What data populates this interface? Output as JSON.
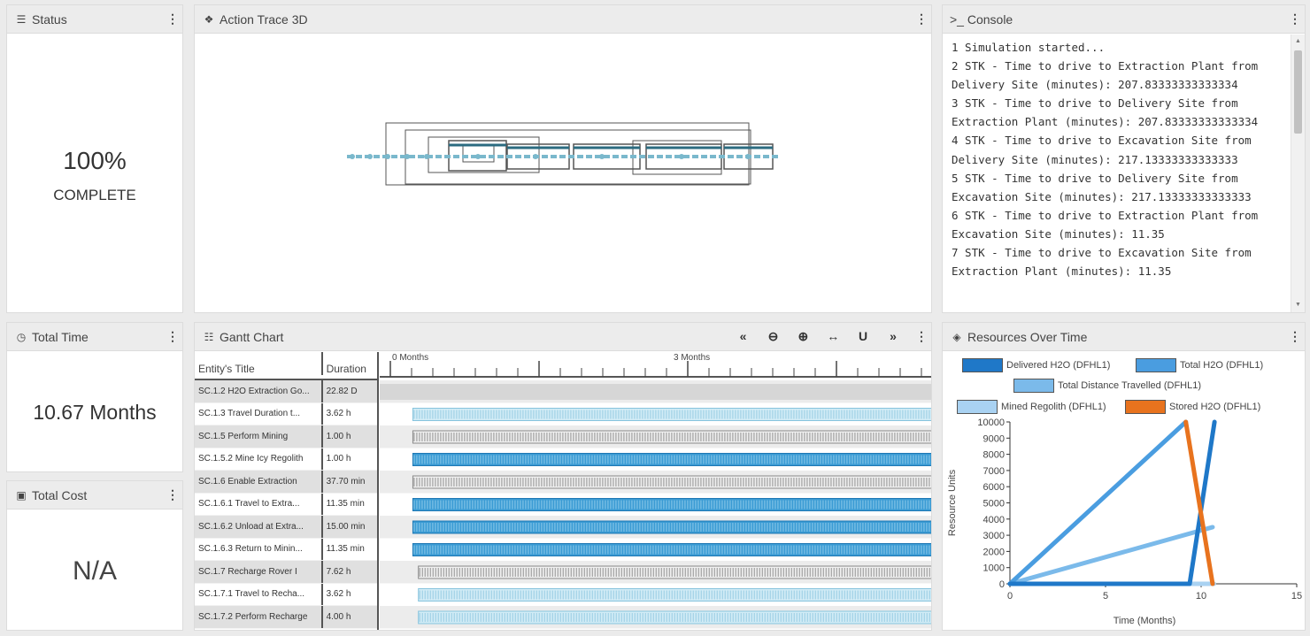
{
  "status": {
    "title": "Status",
    "value": "100%",
    "label": "COMPLETE"
  },
  "trace": {
    "title": "Action Trace 3D"
  },
  "console": {
    "title": ">_ Console",
    "lines": [
      "1 Simulation started...",
      "2 STK - Time to drive to Extraction Plant from Delivery Site (minutes): 207.83333333333334",
      "3 STK - Time to drive to Delivery Site from Extraction Plant (minutes): 207.83333333333334",
      "4 STK - Time to drive to Excavation Site from Delivery Site (minutes): 217.13333333333333",
      "5 STK - Time to drive to Delivery Site from Excavation Site (minutes): 217.13333333333333",
      "6 STK - Time to drive to Extraction Plant from Excavation Site (minutes): 11.35",
      "7 STK - Time to drive to Excavation Site from Extraction Plant (minutes): 11.35"
    ]
  },
  "total_time": {
    "title": "Total Time",
    "value": "10.67 Months"
  },
  "total_cost": {
    "title": "Total Cost",
    "value": "N/A"
  },
  "gantt": {
    "title": "Gantt Chart",
    "tools": [
      "«",
      "⊖",
      "⊕",
      "↔",
      "U",
      "»"
    ],
    "col_title": "Entity's Title",
    "col_duration": "Duration",
    "timeline_labels": [
      "0 Months",
      "3 Months"
    ],
    "rows": [
      {
        "title": "SC.1.2 H2O Extraction Go...",
        "duration": "22.82 D",
        "style": "none",
        "start": 0,
        "end": 1
      },
      {
        "title": "SC.1.3 Travel Duration t...",
        "duration": "3.62 h",
        "style": "light",
        "start": 0.06,
        "end": 1
      },
      {
        "title": "SC.1.5 Perform Mining",
        "duration": "1.00 h",
        "style": "grey",
        "start": 0.06,
        "end": 1
      },
      {
        "title": "SC.1.5.2 Mine Icy Regolith",
        "duration": "1.00 h",
        "style": "blue",
        "start": 0.06,
        "end": 1
      },
      {
        "title": "SC.1.6 Enable Extraction",
        "duration": "37.70 min",
        "style": "grey",
        "start": 0.06,
        "end": 1
      },
      {
        "title": "SC.1.6.1 Travel to Extra...",
        "duration": "11.35 min",
        "style": "blue",
        "start": 0.06,
        "end": 1
      },
      {
        "title": "SC.1.6.2 Unload at Extra...",
        "duration": "15.00 min",
        "style": "blue",
        "start": 0.06,
        "end": 1
      },
      {
        "title": "SC.1.6.3 Return to Minin...",
        "duration": "11.35 min",
        "style": "blue",
        "start": 0.06,
        "end": 1
      },
      {
        "title": "SC.1.7 Recharge Rover I",
        "duration": "7.62 h",
        "style": "grey",
        "start": 0.07,
        "end": 1
      },
      {
        "title": "SC.1.7.1 Travel to Recha...",
        "duration": "3.62 h",
        "style": "light",
        "start": 0.07,
        "end": 1
      },
      {
        "title": "SC.1.7.2 Perform Recharge",
        "duration": "4.00 h",
        "style": "light",
        "start": 0.07,
        "end": 1
      }
    ]
  },
  "resources": {
    "title": "Resources Over Time",
    "colors": {
      "delivered": "#1f78c8",
      "total": "#4a9de0",
      "distance": "#7bbaea",
      "mined": "#a9d2f2",
      "stored": "#e8731e"
    }
  },
  "chart_data": {
    "type": "line",
    "xlabel": "Time (Months)",
    "ylabel": "Resource Units",
    "xlim": [
      0,
      15
    ],
    "ylim": [
      0,
      10000
    ],
    "xticks": [
      0,
      5,
      10,
      15
    ],
    "yticks": [
      0,
      1000,
      2000,
      3000,
      4000,
      5000,
      6000,
      7000,
      8000,
      9000,
      10000
    ],
    "legend_placement": "top",
    "series": [
      {
        "name": "Delivered H2O (DFHL1)",
        "color": "#1f78c8",
        "x": [
          0,
          9.4,
          10.7
        ],
        "y": [
          0,
          0,
          10000
        ]
      },
      {
        "name": "Total H2O (DFHL1)",
        "color": "#4a9de0",
        "x": [
          0,
          9.2
        ],
        "y": [
          0,
          10000
        ]
      },
      {
        "name": "Total Distance Travelled (DFHL1)",
        "color": "#7bbaea",
        "x": [
          0,
          10.6
        ],
        "y": [
          0,
          3500
        ]
      },
      {
        "name": "Mined Regolith (DFHL1)",
        "color": "#a9d2f2",
        "x": [
          0,
          10.67
        ],
        "y": [
          0,
          0
        ]
      },
      {
        "name": "Stored H2O (DFHL1)",
        "color": "#e8731e",
        "x": [
          9.2,
          10.6
        ],
        "y": [
          10000,
          0
        ]
      }
    ]
  }
}
